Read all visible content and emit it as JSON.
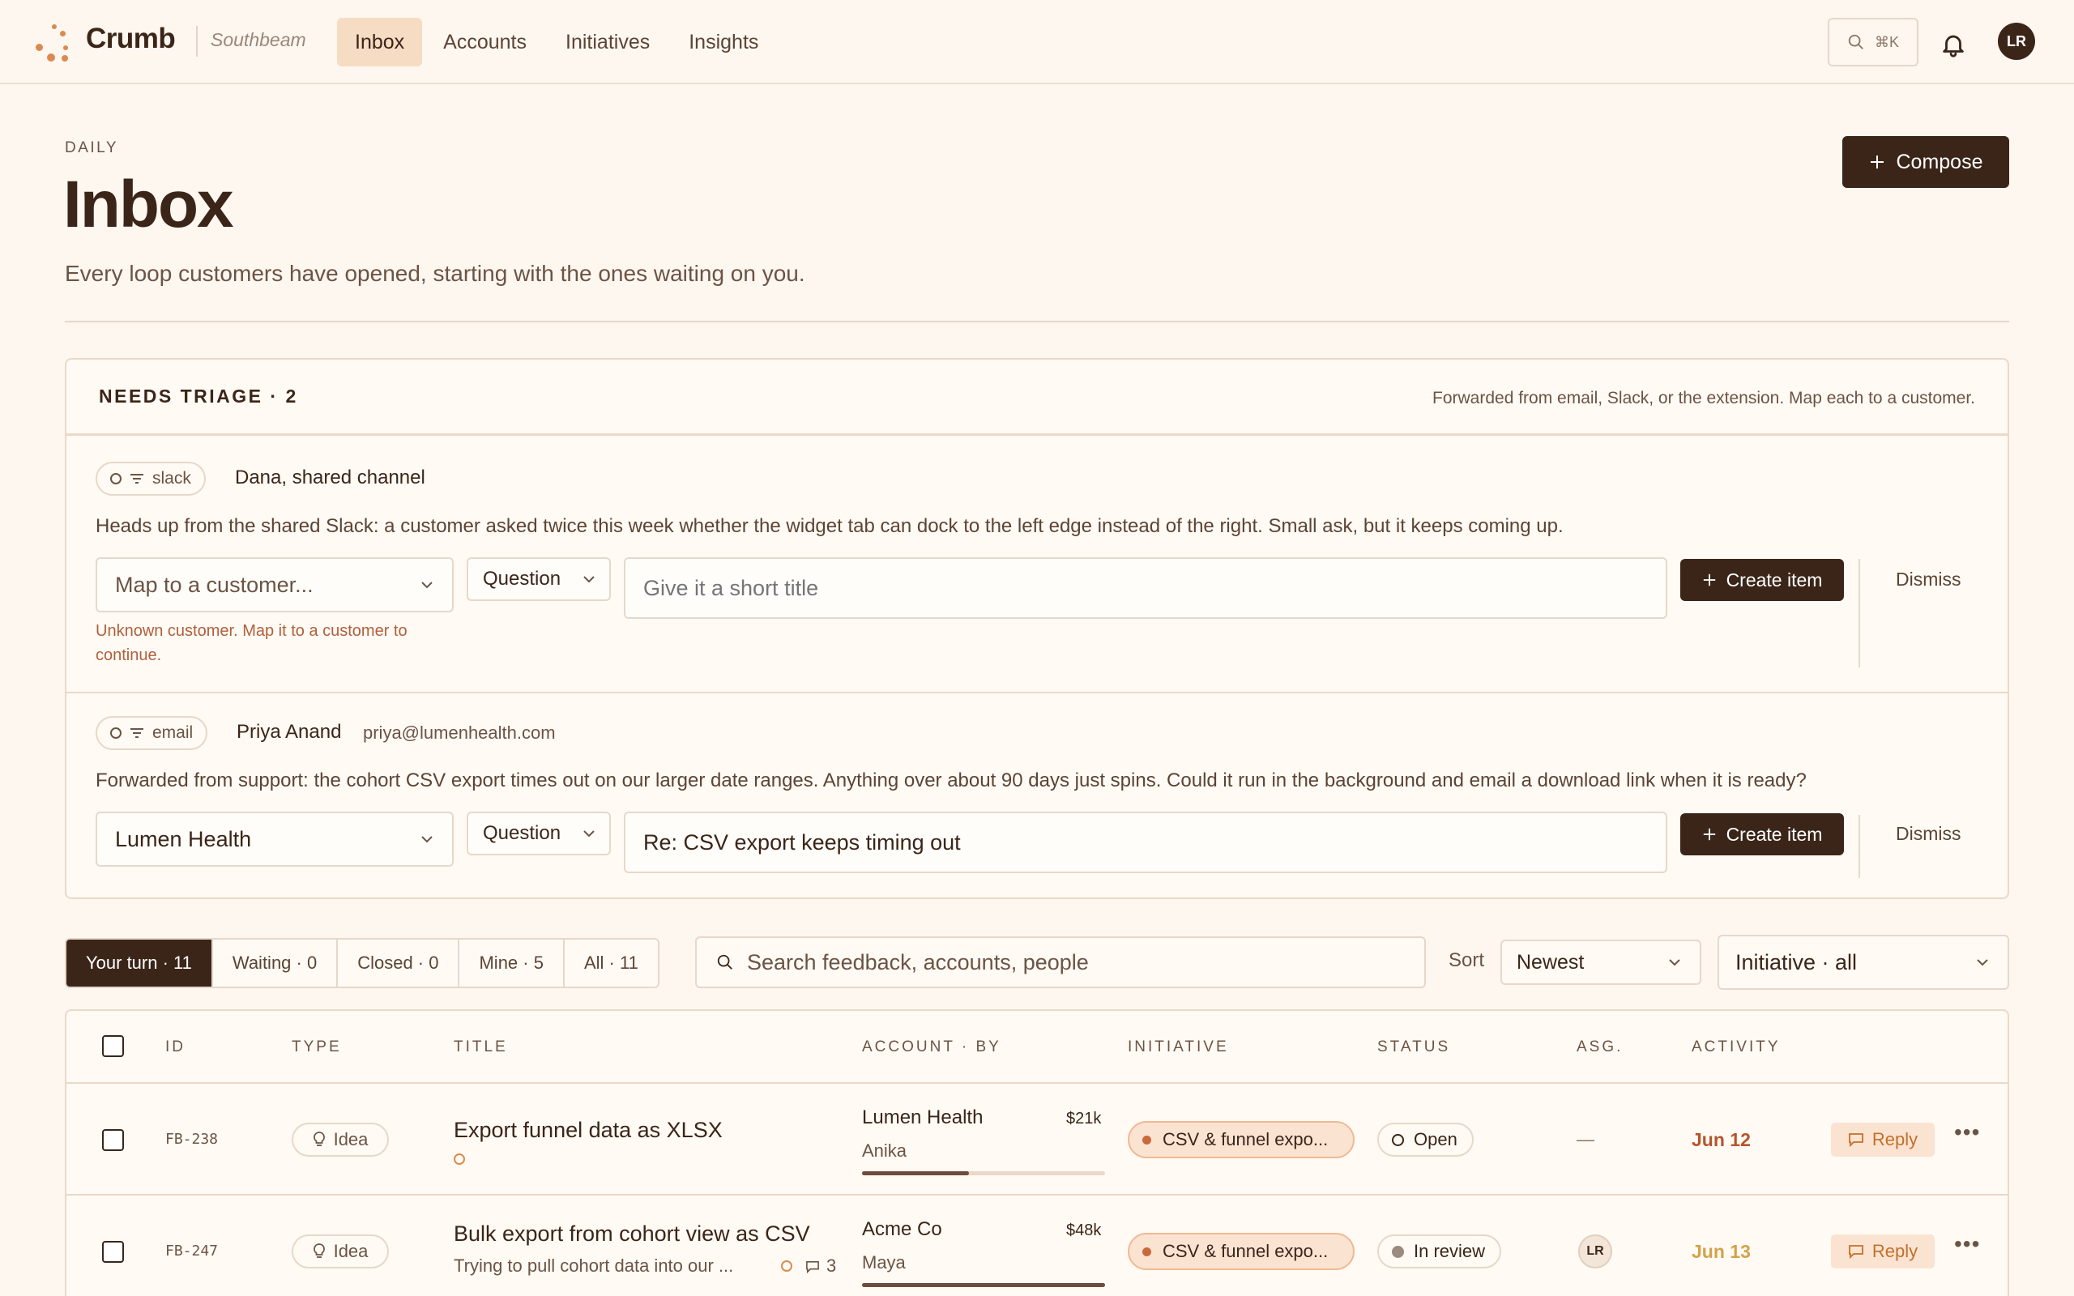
{
  "app": {
    "brand": "Crumb",
    "workspace": "Southbeam",
    "nav": [
      "Inbox",
      "Accounts",
      "Initiatives",
      "Insights"
    ],
    "active_nav": "Inbox",
    "search_shortcut": "⌘K",
    "user_initials": "LR"
  },
  "header": {
    "eyebrow": "DAILY",
    "title": "Inbox",
    "subtitle": "Every loop customers have opened, starting with the ones waiting on you.",
    "compose_label": "Compose"
  },
  "triage": {
    "title": "NEEDS TRIAGE · 2",
    "note": "Forwarded from email, Slack, or the extension. Map each to a customer.",
    "items": [
      {
        "source": "slack",
        "from": "Dana, shared channel",
        "email": "",
        "body": "Heads up from the shared Slack: a customer asked twice this week whether the widget tab can dock to the left edge instead of the right. Small ask, but it keeps coming up.",
        "customer_placeholder": "Map to a customer...",
        "customer_value": "",
        "type": "Question",
        "title_placeholder": "Give it a short title",
        "title_value": "",
        "error": "Unknown customer. Map it to a customer to continue.",
        "create_label": "Create item",
        "dismiss_label": "Dismiss"
      },
      {
        "source": "email",
        "from": "Priya Anand",
        "email": "priya@lumenhealth.com",
        "body": "Forwarded from support: the cohort CSV export times out on our larger date ranges. Anything over about 90 days just spins. Could it run in the background and email a download link when it is ready?",
        "customer_placeholder": "",
        "customer_value": "Lumen Health",
        "type": "Question",
        "title_placeholder": "",
        "title_value": "Re: CSV export keeps timing out",
        "error": "",
        "create_label": "Create item",
        "dismiss_label": "Dismiss"
      }
    ]
  },
  "filters": {
    "tabs": [
      {
        "label": "Your turn · 11",
        "active": true
      },
      {
        "label": "Waiting · 0",
        "active": false
      },
      {
        "label": "Closed · 0",
        "active": false
      },
      {
        "label": "Mine · 5",
        "active": false
      },
      {
        "label": "All · 11",
        "active": false
      }
    ],
    "search_placeholder": "Search feedback, accounts, people",
    "sort_label": "Sort",
    "sort_value": "Newest",
    "initiative_value": "Initiative · all"
  },
  "table": {
    "columns": [
      "ID",
      "TYPE",
      "TITLE",
      "ACCOUNT · BY",
      "INITIATIVE",
      "STATUS",
      "ASG.",
      "ACTIVITY"
    ],
    "rows": [
      {
        "id": "FB-238",
        "type": "Idea",
        "title": "Export funnel data as XLSX",
        "excerpt": "",
        "comments": "",
        "account": "Lumen Health",
        "by": "Anika",
        "amount": "$21k",
        "account_bar": 0.44,
        "initiative": "CSV & funnel expo...",
        "status": "Open",
        "assignee": "—",
        "activity": "Jun 12",
        "activity_color": "#b5552b",
        "reply_label": "Reply"
      },
      {
        "id": "FB-247",
        "type": "Idea",
        "title": "Bulk export from cohort view as CSV",
        "excerpt": "Trying to pull cohort data into our ...",
        "comments": "3",
        "account": "Acme Co",
        "by": "Maya",
        "amount": "$48k",
        "account_bar": 1.0,
        "initiative": "CSV & funnel expo...",
        "status": "In review",
        "assignee": "LR",
        "activity": "Jun 13",
        "activity_color": "#d4a24a",
        "reply_label": "Reply"
      }
    ]
  },
  "colors": {
    "background": "#fdf7f0",
    "primary": "#3b2519",
    "accent": "#d98b4f",
    "error": "#b0603c"
  }
}
